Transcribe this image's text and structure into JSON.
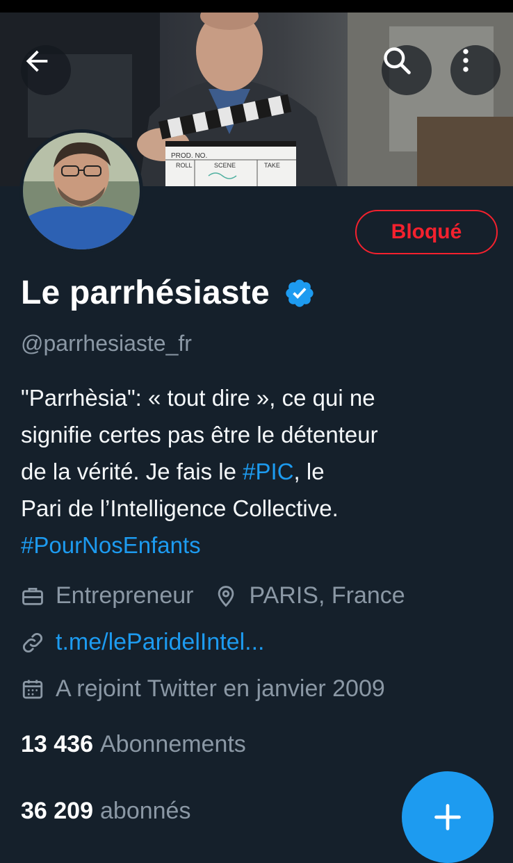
{
  "header": {
    "back_icon": "arrow-left-icon",
    "search_icon": "search-icon",
    "more_icon": "more-vertical-icon"
  },
  "banner": {
    "clapperboard": {
      "prod_no_label": "PROD. NO.",
      "roll_label": "ROLL",
      "scene_label": "SCENE",
      "take_label": "TAKE"
    }
  },
  "profile": {
    "display_name": "Le parrhésiaste",
    "verified_icon": "verified-badge-icon",
    "handle": "@parrhesiaste_fr",
    "blocked_label": "Bloqué",
    "bio": {
      "line1": "\"Parrhèsia\": « tout dire », ce qui ne",
      "line2": "signifie certes pas être le détenteur",
      "line3_before": "de la vérité. Je fais le ",
      "line3_hashtag": "#PIC",
      "line3_after": ", le",
      "line4": "Pari de l’Intelligence Collective.",
      "line5_hashtag": "#PourNosEnfants"
    },
    "profession": "Entrepreneur",
    "location": "PARIS, France",
    "link": "t.me/leParidelIntel...",
    "joined": "A rejoint Twitter en janvier 2009",
    "following_count": "13 436",
    "following_label": "Abonnements",
    "followers_count": "36 209",
    "followers_label": "abonnés"
  },
  "colors": {
    "background": "#15202b",
    "accent": "#1d9bf0",
    "blocked": "#f4212e",
    "secondary_text": "#8b98a5"
  }
}
